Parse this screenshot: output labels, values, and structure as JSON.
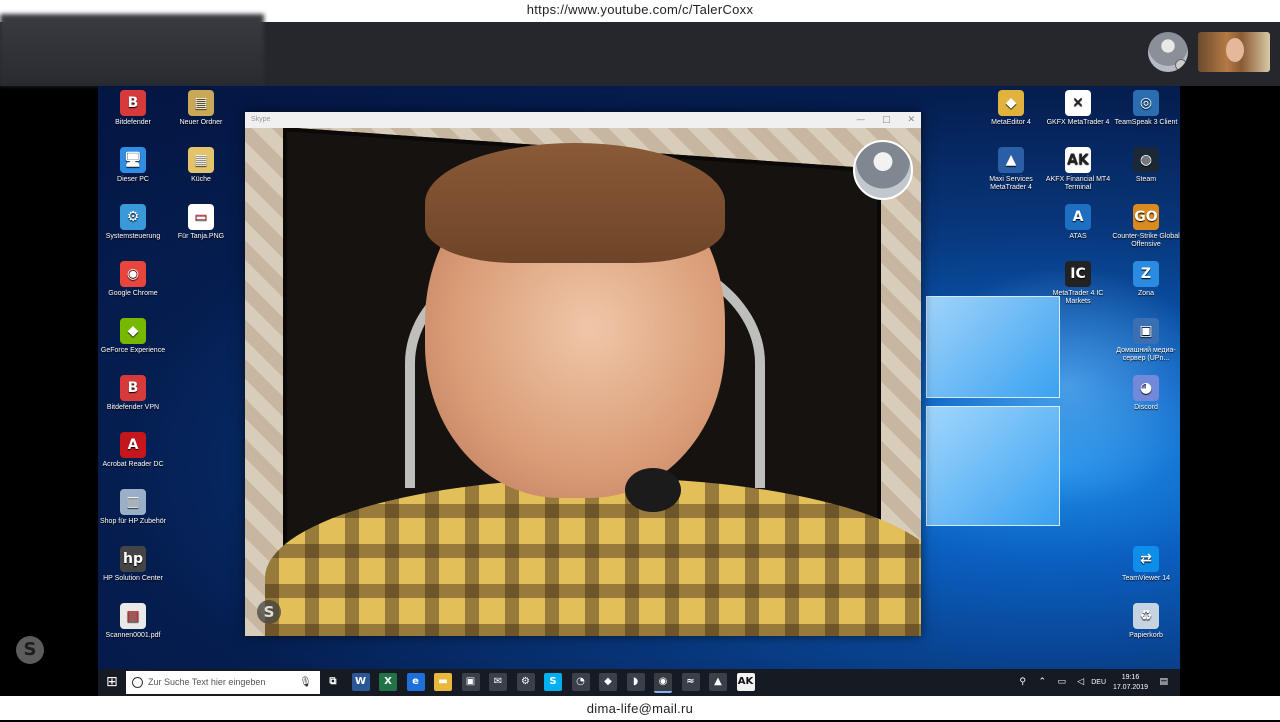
{
  "banner": {
    "top_url": "https://www.youtube.com/c/TalerCoxx",
    "bottom_email": "dima-life@mail.ru"
  },
  "skype_window": {
    "title": "Skype",
    "controls": [
      "—",
      "□",
      "✕"
    ],
    "watermark": "S"
  },
  "left_skype_logo": "S",
  "desktop_icons_left": [
    {
      "label": "Bitdefender",
      "glyph": "B",
      "color": "#d63a3a"
    },
    {
      "label": "Neuer Ordner",
      "glyph": "▤",
      "color": "#c9a857"
    },
    {
      "label": "Dieser PC",
      "glyph": "🖥",
      "color": "#2f8de4"
    },
    {
      "label": "Küche",
      "glyph": "▦",
      "color": "#e3c46b"
    },
    {
      "label": "Systemsteuerung",
      "glyph": "⚙",
      "color": "#3a9ad9"
    },
    {
      "label": "Für Tanja.PNG",
      "glyph": "▭",
      "color": "#ffffff"
    },
    {
      "label": "Google Chrome",
      "glyph": "◉",
      "color": "#e8453c"
    },
    {
      "label": "GeForce Experience",
      "glyph": "◆",
      "color": "#76b900"
    },
    {
      "label": "Bitdefender VPN",
      "glyph": "B",
      "color": "#d63a3a"
    },
    {
      "label": "Acrobat Reader DC",
      "glyph": "A",
      "color": "#c4161c"
    },
    {
      "label": "Shop für HP Zubehör",
      "glyph": "▥",
      "color": "#9ab0c8"
    },
    {
      "label": "HP Solution Center",
      "glyph": "hp",
      "color": "#444444"
    },
    {
      "label": "Scannen0001.pdf",
      "glyph": "▤",
      "color": "#e9e9e9"
    }
  ],
  "desktop_icons_right": [
    {
      "label": "MetaEditor 4",
      "glyph": "◆",
      "color": "#e1b23c"
    },
    {
      "label": "GKFX MetaTrader 4",
      "glyph": "✕",
      "color": "#ffffff"
    },
    {
      "label": "TeamSpeak 3 Client",
      "glyph": "◎",
      "color": "#2a6db0"
    },
    {
      "label": "Maxi Services MetaTrader 4",
      "glyph": "▲",
      "color": "#2a5fa8"
    },
    {
      "label": "AKFX Financial MT4 Terminal",
      "glyph": "AK",
      "color": "#ffffff"
    },
    {
      "label": "Steam",
      "glyph": "◍",
      "color": "#1b2838"
    },
    {
      "label": "ATAS",
      "glyph": "A",
      "color": "#1e6fc0"
    },
    {
      "label": "Counter-Strike Global Offensive",
      "glyph": "GO",
      "color": "#d98b1f"
    },
    {
      "label": "MetaTrader 4 IC Markets",
      "glyph": "IC",
      "color": "#222222"
    },
    {
      "label": "Zona",
      "glyph": "Z",
      "color": "#2b8be0"
    },
    {
      "label": "Домашний медиа-сервер (UPn...",
      "glyph": "▣",
      "color": "#3b6fb3"
    },
    {
      "label": "Discord",
      "glyph": "◕",
      "color": "#7289da"
    },
    {
      "label": "TeamViewer 14",
      "glyph": "⇄",
      "color": "#0e8ee9"
    },
    {
      "label": "Papierkorb",
      "glyph": "♻",
      "color": "#c6d3e0"
    }
  ],
  "taskbar": {
    "search_placeholder": "Zur Suche Text hier eingeben",
    "apps": [
      {
        "name": "task-view",
        "glyph": "⧉",
        "color": "#161a22"
      },
      {
        "name": "word",
        "glyph": "W",
        "color": "#2b5797"
      },
      {
        "name": "excel",
        "glyph": "X",
        "color": "#217346"
      },
      {
        "name": "edge",
        "glyph": "e",
        "color": "#1e6fd9"
      },
      {
        "name": "explorer",
        "glyph": "▬",
        "color": "#e8b73c"
      },
      {
        "name": "store",
        "glyph": "▣",
        "color": "#3a3f4a"
      },
      {
        "name": "mail",
        "glyph": "✉",
        "color": "#3a3f4a"
      },
      {
        "name": "settings",
        "glyph": "⚙",
        "color": "#3a3f4a"
      },
      {
        "name": "skype",
        "glyph": "S",
        "color": "#00aff0"
      },
      {
        "name": "cat-app",
        "glyph": "◔",
        "color": "#3a3f4a"
      },
      {
        "name": "metaeditor",
        "glyph": "◆",
        "color": "#3a3f4a"
      },
      {
        "name": "car-app",
        "glyph": "◗",
        "color": "#3a3f4a"
      },
      {
        "name": "chrome",
        "glyph": "◉",
        "color": "#e8453c",
        "active": true
      },
      {
        "name": "metatrader",
        "glyph": "≈",
        "color": "#3a3f4a"
      },
      {
        "name": "maxi-mt4",
        "glyph": "▲",
        "color": "#3a3f4a"
      },
      {
        "name": "akfx",
        "glyph": "AK",
        "color": "#f2f2f2"
      }
    ],
    "tray": {
      "language": "DEU",
      "time": "19:16",
      "date": "17.07.2019"
    }
  }
}
